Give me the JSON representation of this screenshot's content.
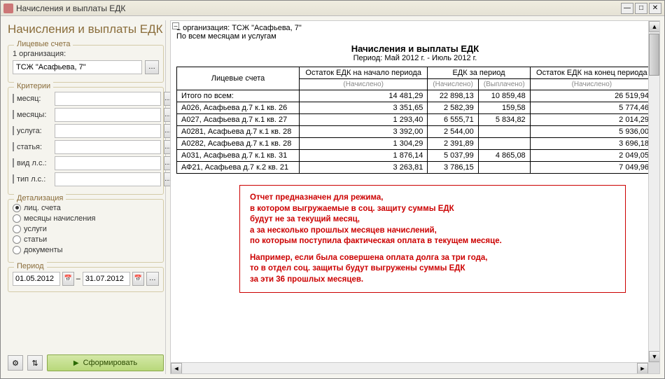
{
  "window": {
    "title": "Начисления и выплаты ЕДК"
  },
  "heading": "Начисления и выплаты ЕДК",
  "accounts": {
    "legend": "Лицевые счета",
    "org_label": "1   организация:",
    "org_value": "ТСЖ \"Асафьева, 7\""
  },
  "criteria": {
    "legend": "Критерии",
    "items": [
      {
        "label": "месяц:"
      },
      {
        "label": "месяцы:"
      },
      {
        "label": "услуга:"
      },
      {
        "label": "статья:"
      },
      {
        "label": "вид л.с.:"
      },
      {
        "label": "тип л.с.:"
      }
    ]
  },
  "detail": {
    "legend": "Детализация",
    "options": [
      {
        "label": "лиц. счета",
        "checked": true
      },
      {
        "label": "месяцы начисления",
        "checked": false
      },
      {
        "label": "услуги",
        "checked": false
      },
      {
        "label": "статьи",
        "checked": false
      },
      {
        "label": "документы",
        "checked": false
      }
    ]
  },
  "period": {
    "legend": "Период",
    "from": "01.05.2012",
    "to": "31.07.2012"
  },
  "form_btn": "Сформировать",
  "report": {
    "org_line": "1 организация: ТСЖ \"Асафьева, 7\"",
    "filter_line": "По всем месяцам и услугам",
    "title": "Начисления и выплаты ЕДК",
    "period": "Период: Май 2012 г. - Июль 2012 г.",
    "headers": {
      "col1": "Лицевые счета",
      "col2": "Остаток ЕДК на начало периода",
      "col3": "ЕДК за период",
      "col4": "Остаток ЕДК на конец периода",
      "sub_accr": "(Начислено)",
      "sub_paid": "(Выплачено)"
    },
    "total_label": "Итого по всем:",
    "total": {
      "start": "14 481,29",
      "accr": "22 898,13",
      "paid": "10 859,48",
      "end": "26 519,94"
    },
    "rows": [
      {
        "name": "А026, Асафьева д.7 к.1 кв. 26",
        "start": "3 351,65",
        "accr": "2 582,39",
        "paid": "159,58",
        "end": "5 774,46"
      },
      {
        "name": "А027, Асафьева д.7 к.1 кв. 27",
        "start": "1 293,40",
        "accr": "6 555,71",
        "paid": "5 834,82",
        "end": "2 014,29"
      },
      {
        "name": "А0281, Асафьева д.7 к.1 кв. 28",
        "start": "3 392,00",
        "accr": "2 544,00",
        "paid": "",
        "end": "5 936,00"
      },
      {
        "name": "А0282, Асафьева д.7 к.1 кв. 28",
        "start": "1 304,29",
        "accr": "2 391,89",
        "paid": "",
        "end": "3 696,18"
      },
      {
        "name": "А031, Асафьева д.7 к.1 кв. 31",
        "start": "1 876,14",
        "accr": "5 037,99",
        "paid": "4 865,08",
        "end": "2 049,05"
      },
      {
        "name": "АФ21, Асафьева д.7 к.2 кв. 21",
        "start": "3 263,81",
        "accr": "3 786,15",
        "paid": "",
        "end": "7 049,96"
      }
    ],
    "note": {
      "l1": "Отчет предназначен для режима,",
      "l2": "в котором выгружаемые в соц. защиту суммы ЕДК",
      "l3": "будут не за текущий месяц,",
      "l4": "а за несколько прошлых месяцев начислений,",
      "l5": "по которым поступила фактическая оплата в текущем месяце.",
      "l6": "Например, если была совершена оплата долга за три года,",
      "l7": "то в отдел соц. защиты будут выгружены суммы ЕДК",
      "l8": "за эти 36 прошлых месяцев."
    }
  }
}
